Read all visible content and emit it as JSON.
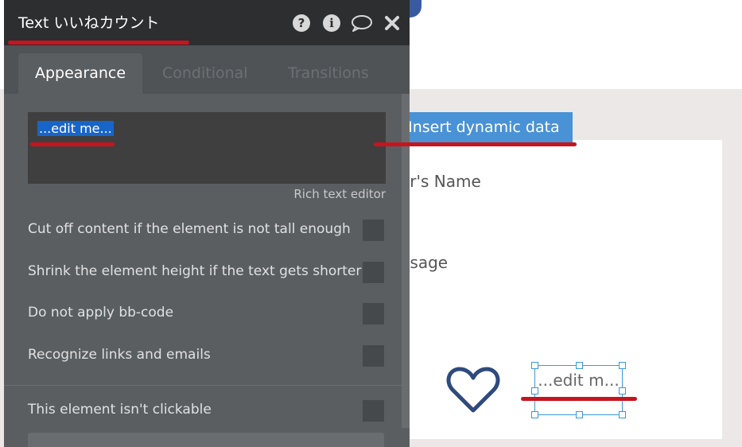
{
  "panel": {
    "title": "Text いいねカウント",
    "header_icons": [
      "help-icon",
      "info-icon",
      "comment-icon",
      "close-icon"
    ],
    "tabs": [
      {
        "label": "Appearance",
        "active": true
      },
      {
        "label": "Conditional",
        "active": false
      },
      {
        "label": "Transitions",
        "active": false
      }
    ],
    "rich_text": {
      "value": "...edit me...",
      "editor_link": "Rich text editor"
    },
    "options": [
      {
        "label": "Cut off content if the element is not tall enough",
        "checked": false
      },
      {
        "label": "Shrink the element height if the text gets shorter",
        "checked": false
      },
      {
        "label": "Do not apply bb-code",
        "checked": false
      },
      {
        "label": "Recognize links and emails",
        "checked": false
      },
      {
        "label": "This element isn't clickable",
        "checked": false
      }
    ]
  },
  "insert_dynamic": {
    "label": "Insert dynamic data",
    "icon": "chevron-right-icon"
  },
  "canvas": {
    "name_text": "er's Name",
    "message_text": "ssage",
    "selected_text": "...edit m...",
    "heart_icon": "heart-icon"
  },
  "colors": {
    "annotation_red": "#c8141e",
    "accent_blue": "#4a92d6",
    "selection_blue": "#3a9ad9",
    "panel_bg": "#5b5e61",
    "header_bg": "#2c2e30"
  }
}
